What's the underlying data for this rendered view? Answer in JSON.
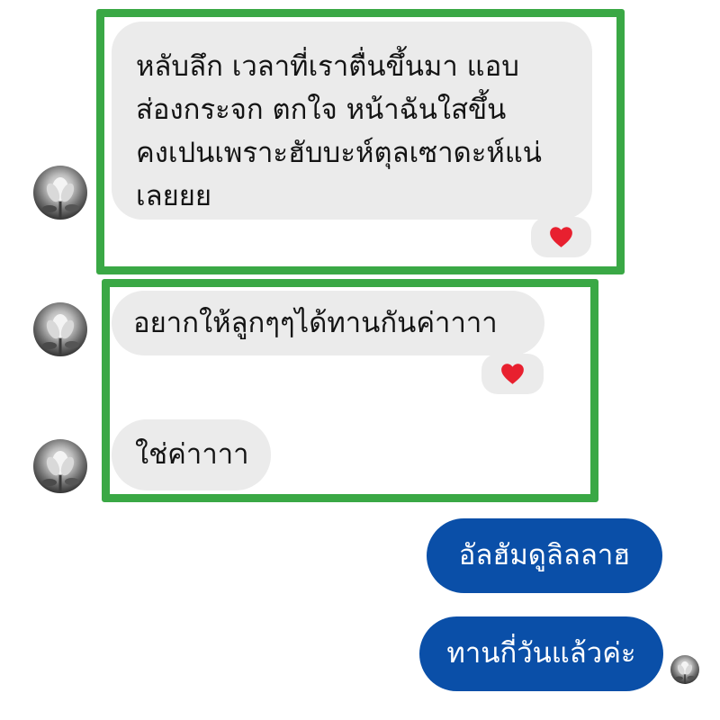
{
  "messages": [
    {
      "sender": "other",
      "text": "หลับลึก เวลาที่เราตื่นขึ้นมา แอบ\nส่องกระจก ตกใจ หน้าฉันใสขึ้น\nคงเปนเพราะฮับบะห์ตุลเซาดะห์แน่\nเลยยย",
      "reaction": "heart"
    },
    {
      "sender": "other",
      "text": "อยากให้ลูกๆๆได้ทานกันค่าาาา",
      "reaction": "heart"
    },
    {
      "sender": "other",
      "text": "ใช่ค่าาาา"
    },
    {
      "sender": "me",
      "text": "อัลฮัมดูลิลลาฮ"
    },
    {
      "sender": "me",
      "text": "ทานกี่วันแล้วค่ะ"
    }
  ],
  "colors": {
    "highlight_border": "#3aa845",
    "incoming_bubble": "#ebebeb",
    "outgoing_bubble": "#0a4fa8",
    "reaction_heart": "#e8202f"
  },
  "icons": {
    "reaction": "red-heart-icon",
    "avatar": "flower-avatar"
  }
}
